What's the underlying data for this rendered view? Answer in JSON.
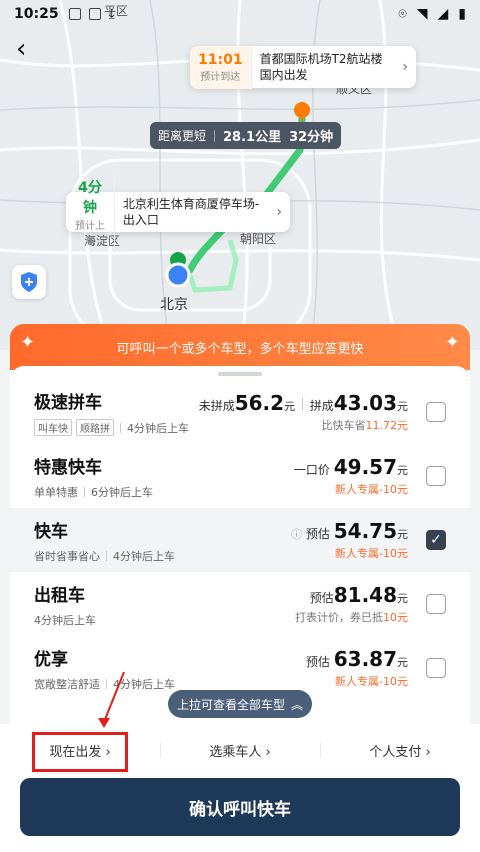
{
  "status_bar": {
    "time": "10:25"
  },
  "map": {
    "labels": [
      "海淀区",
      "北京",
      "朝阳区",
      "顺义区",
      "平区"
    ]
  },
  "destination_bubble": {
    "time": "11:01",
    "time_label": "预计到达",
    "text": "首都国际机场T2航站楼国内出发"
  },
  "distance_tag": {
    "label": "距离更短",
    "distance": "28.1公里",
    "duration": "32分钟"
  },
  "start_bubble": {
    "time": "4分钟",
    "time_label": "预计上车",
    "text": "北京利生体育商厦停车场-出入口"
  },
  "banner": {
    "text": "可呼叫一个或多个车型，多个车型应答更快"
  },
  "cars": [
    {
      "name": "极速拼车",
      "tags": [
        "叫车快",
        "顺路拼"
      ],
      "eta": "4分钟后上车",
      "price_prefix_1": "未拼成",
      "price_1": "56.2",
      "price_prefix_2": "拼成",
      "price_2": "43.03",
      "unit": "元",
      "note_prefix": "比快车省",
      "note_value": "11.72元",
      "checked": false
    },
    {
      "name": "特惠快车",
      "desc": "单单特惠",
      "eta": "6分钟后上车",
      "price_prefix": "一口价",
      "price": "49.57",
      "unit": "元",
      "note": "新人专属-10元",
      "checked": false
    },
    {
      "name": "快车",
      "desc": "省时省事省心",
      "eta": "4分钟后上车",
      "price_prefix": "预估",
      "price": "54.75",
      "unit": "元",
      "note": "新人专属-10元",
      "checked": true
    },
    {
      "name": "出租车",
      "eta": "4分钟后上车",
      "price_prefix": "预估",
      "price": "81.48",
      "unit": "元",
      "note_prefix": "打表计价，券已抵",
      "note_value": "10元",
      "checked": false
    },
    {
      "name": "优享",
      "desc": "宽敞整洁舒适",
      "eta": "4分钟后上车",
      "price_prefix": "预估",
      "price": "63.87",
      "unit": "元",
      "note": "新人专属-10元",
      "checked": false
    }
  ],
  "pullup": {
    "text": "上拉可查看全部车型"
  },
  "options": {
    "depart_now": "现在出发",
    "choose_passenger": "选乘车人",
    "personal_pay": "个人支付"
  },
  "confirm": {
    "label": "确认呼叫快车"
  },
  "colors": {
    "accent": "#ff6a2b",
    "primary": "#1e3858",
    "highlight": "#e11d1d"
  },
  "icons": {
    "check": "✓",
    "chevron": "›"
  }
}
